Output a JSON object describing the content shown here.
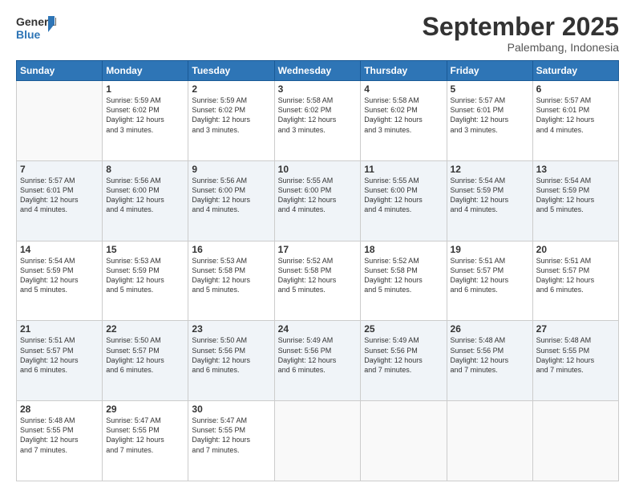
{
  "logo": {
    "line1": "General",
    "line2": "Blue"
  },
  "title": "September 2025",
  "subtitle": "Palembang, Indonesia",
  "days": [
    "Sunday",
    "Monday",
    "Tuesday",
    "Wednesday",
    "Thursday",
    "Friday",
    "Saturday"
  ],
  "weeks": [
    [
      {
        "day": "",
        "info": ""
      },
      {
        "day": "1",
        "info": "Sunrise: 5:59 AM\nSunset: 6:02 PM\nDaylight: 12 hours\nand 3 minutes."
      },
      {
        "day": "2",
        "info": "Sunrise: 5:59 AM\nSunset: 6:02 PM\nDaylight: 12 hours\nand 3 minutes."
      },
      {
        "day": "3",
        "info": "Sunrise: 5:58 AM\nSunset: 6:02 PM\nDaylight: 12 hours\nand 3 minutes."
      },
      {
        "day": "4",
        "info": "Sunrise: 5:58 AM\nSunset: 6:02 PM\nDaylight: 12 hours\nand 3 minutes."
      },
      {
        "day": "5",
        "info": "Sunrise: 5:57 AM\nSunset: 6:01 PM\nDaylight: 12 hours\nand 3 minutes."
      },
      {
        "day": "6",
        "info": "Sunrise: 5:57 AM\nSunset: 6:01 PM\nDaylight: 12 hours\nand 4 minutes."
      }
    ],
    [
      {
        "day": "7",
        "info": "Sunrise: 5:57 AM\nSunset: 6:01 PM\nDaylight: 12 hours\nand 4 minutes."
      },
      {
        "day": "8",
        "info": "Sunrise: 5:56 AM\nSunset: 6:00 PM\nDaylight: 12 hours\nand 4 minutes."
      },
      {
        "day": "9",
        "info": "Sunrise: 5:56 AM\nSunset: 6:00 PM\nDaylight: 12 hours\nand 4 minutes."
      },
      {
        "day": "10",
        "info": "Sunrise: 5:55 AM\nSunset: 6:00 PM\nDaylight: 12 hours\nand 4 minutes."
      },
      {
        "day": "11",
        "info": "Sunrise: 5:55 AM\nSunset: 6:00 PM\nDaylight: 12 hours\nand 4 minutes."
      },
      {
        "day": "12",
        "info": "Sunrise: 5:54 AM\nSunset: 5:59 PM\nDaylight: 12 hours\nand 4 minutes."
      },
      {
        "day": "13",
        "info": "Sunrise: 5:54 AM\nSunset: 5:59 PM\nDaylight: 12 hours\nand 5 minutes."
      }
    ],
    [
      {
        "day": "14",
        "info": "Sunrise: 5:54 AM\nSunset: 5:59 PM\nDaylight: 12 hours\nand 5 minutes."
      },
      {
        "day": "15",
        "info": "Sunrise: 5:53 AM\nSunset: 5:59 PM\nDaylight: 12 hours\nand 5 minutes."
      },
      {
        "day": "16",
        "info": "Sunrise: 5:53 AM\nSunset: 5:58 PM\nDaylight: 12 hours\nand 5 minutes."
      },
      {
        "day": "17",
        "info": "Sunrise: 5:52 AM\nSunset: 5:58 PM\nDaylight: 12 hours\nand 5 minutes."
      },
      {
        "day": "18",
        "info": "Sunrise: 5:52 AM\nSunset: 5:58 PM\nDaylight: 12 hours\nand 5 minutes."
      },
      {
        "day": "19",
        "info": "Sunrise: 5:51 AM\nSunset: 5:57 PM\nDaylight: 12 hours\nand 6 minutes."
      },
      {
        "day": "20",
        "info": "Sunrise: 5:51 AM\nSunset: 5:57 PM\nDaylight: 12 hours\nand 6 minutes."
      }
    ],
    [
      {
        "day": "21",
        "info": "Sunrise: 5:51 AM\nSunset: 5:57 PM\nDaylight: 12 hours\nand 6 minutes."
      },
      {
        "day": "22",
        "info": "Sunrise: 5:50 AM\nSunset: 5:57 PM\nDaylight: 12 hours\nand 6 minutes."
      },
      {
        "day": "23",
        "info": "Sunrise: 5:50 AM\nSunset: 5:56 PM\nDaylight: 12 hours\nand 6 minutes."
      },
      {
        "day": "24",
        "info": "Sunrise: 5:49 AM\nSunset: 5:56 PM\nDaylight: 12 hours\nand 6 minutes."
      },
      {
        "day": "25",
        "info": "Sunrise: 5:49 AM\nSunset: 5:56 PM\nDaylight: 12 hours\nand 7 minutes."
      },
      {
        "day": "26",
        "info": "Sunrise: 5:48 AM\nSunset: 5:56 PM\nDaylight: 12 hours\nand 7 minutes."
      },
      {
        "day": "27",
        "info": "Sunrise: 5:48 AM\nSunset: 5:55 PM\nDaylight: 12 hours\nand 7 minutes."
      }
    ],
    [
      {
        "day": "28",
        "info": "Sunrise: 5:48 AM\nSunset: 5:55 PM\nDaylight: 12 hours\nand 7 minutes."
      },
      {
        "day": "29",
        "info": "Sunrise: 5:47 AM\nSunset: 5:55 PM\nDaylight: 12 hours\nand 7 minutes."
      },
      {
        "day": "30",
        "info": "Sunrise: 5:47 AM\nSunset: 5:55 PM\nDaylight: 12 hours\nand 7 minutes."
      },
      {
        "day": "",
        "info": ""
      },
      {
        "day": "",
        "info": ""
      },
      {
        "day": "",
        "info": ""
      },
      {
        "day": "",
        "info": ""
      }
    ]
  ]
}
